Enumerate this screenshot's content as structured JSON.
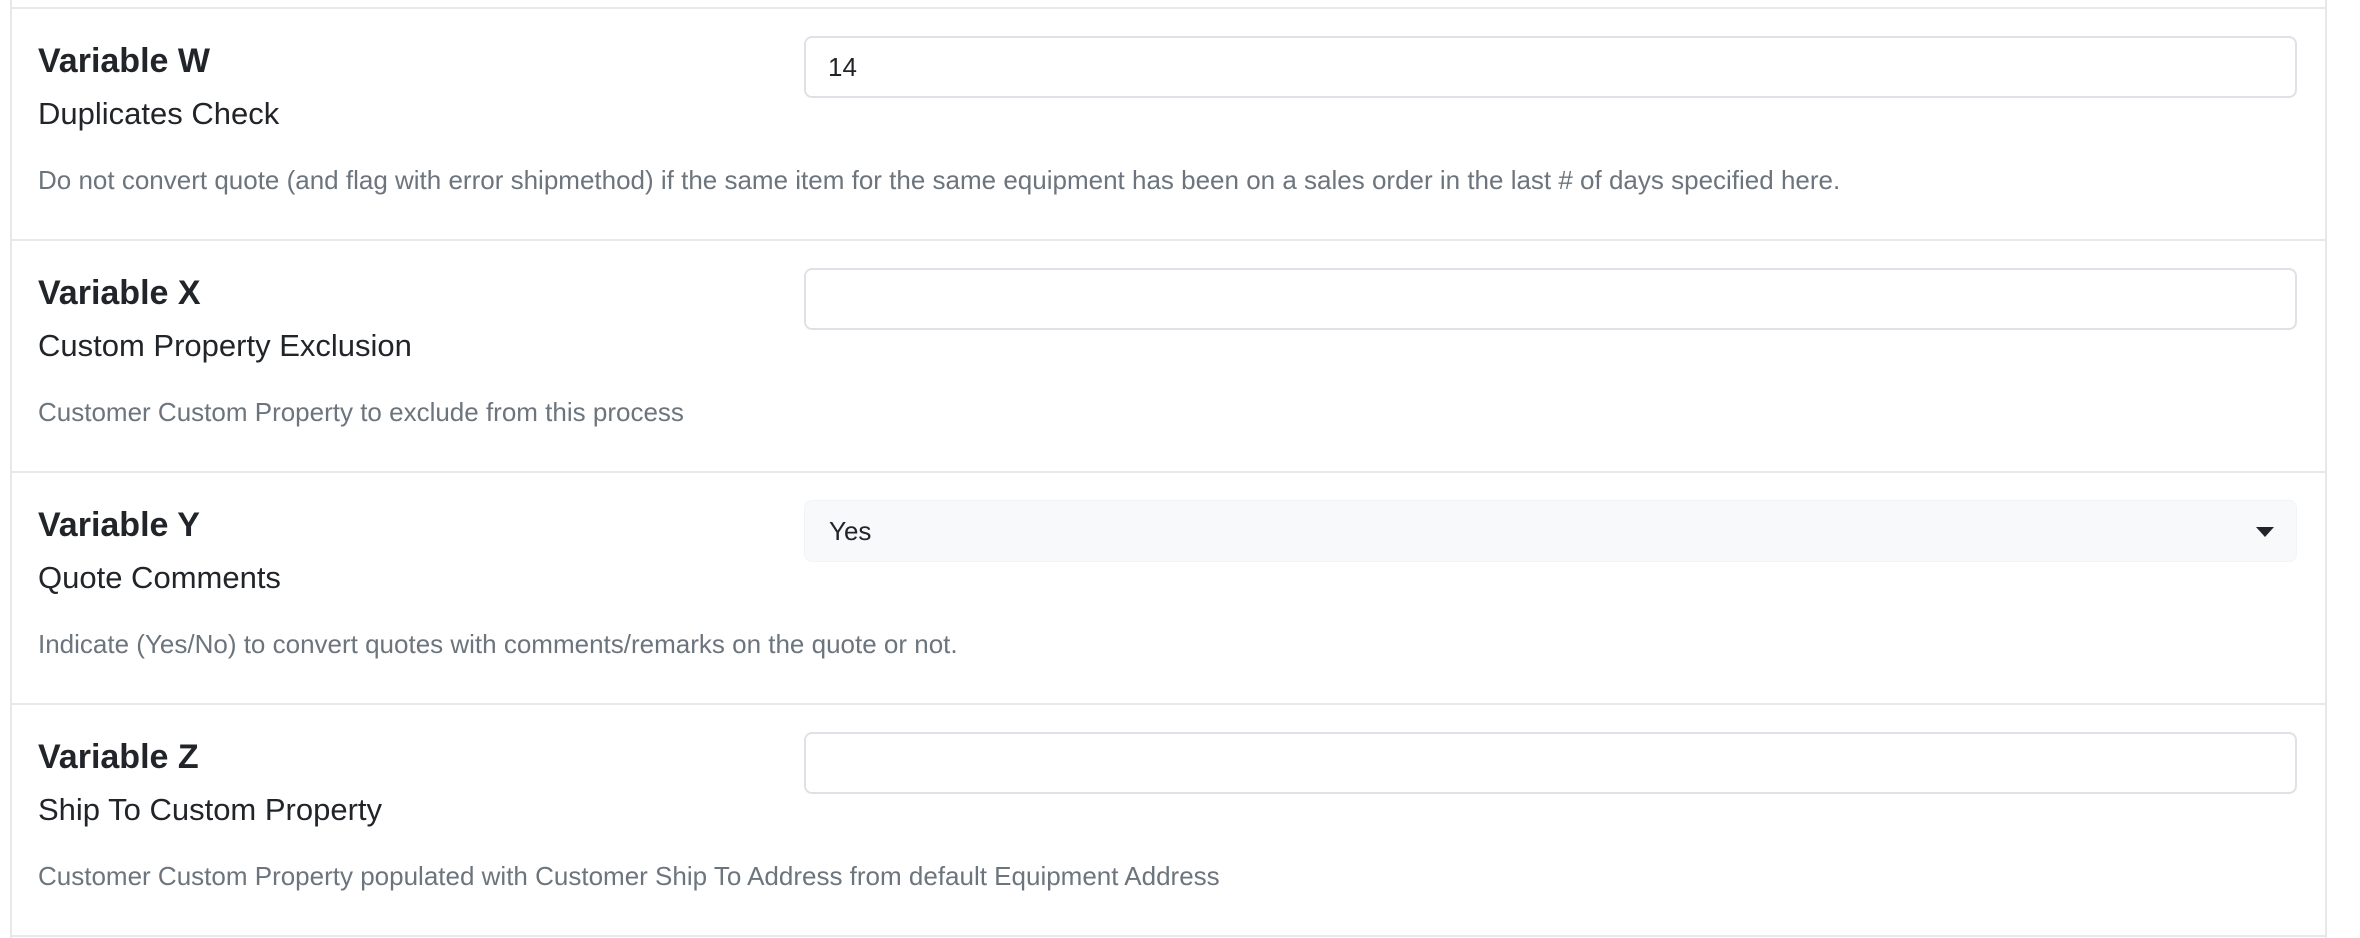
{
  "variables": [
    {
      "title": "Variable W",
      "subtitle": "Duplicates Check",
      "description": "Do not convert quote (and flag with error shipmethod) if the same item for the same equipment has been on a sales order in the last # of days specified here.",
      "control": "text",
      "value": "14"
    },
    {
      "title": "Variable X",
      "subtitle": "Custom Property Exclusion",
      "description": "Customer Custom Property to exclude from this process",
      "control": "text",
      "value": ""
    },
    {
      "title": "Variable Y",
      "subtitle": "Quote Comments",
      "description": "Indicate (Yes/No) to convert quotes with comments/remarks on the quote or not.",
      "control": "select",
      "value": "Yes"
    },
    {
      "title": "Variable Z",
      "subtitle": "Ship To Custom Property",
      "description": "Customer Custom Property populated with Customer Ship To Address from default Equipment Address",
      "control": "text",
      "value": ""
    }
  ],
  "icons": {
    "dropdown": "caret-down-icon"
  },
  "colors": {
    "border": "#e6e8ea",
    "muted_text": "#6c757d",
    "select_bg": "#f8f9fa"
  }
}
